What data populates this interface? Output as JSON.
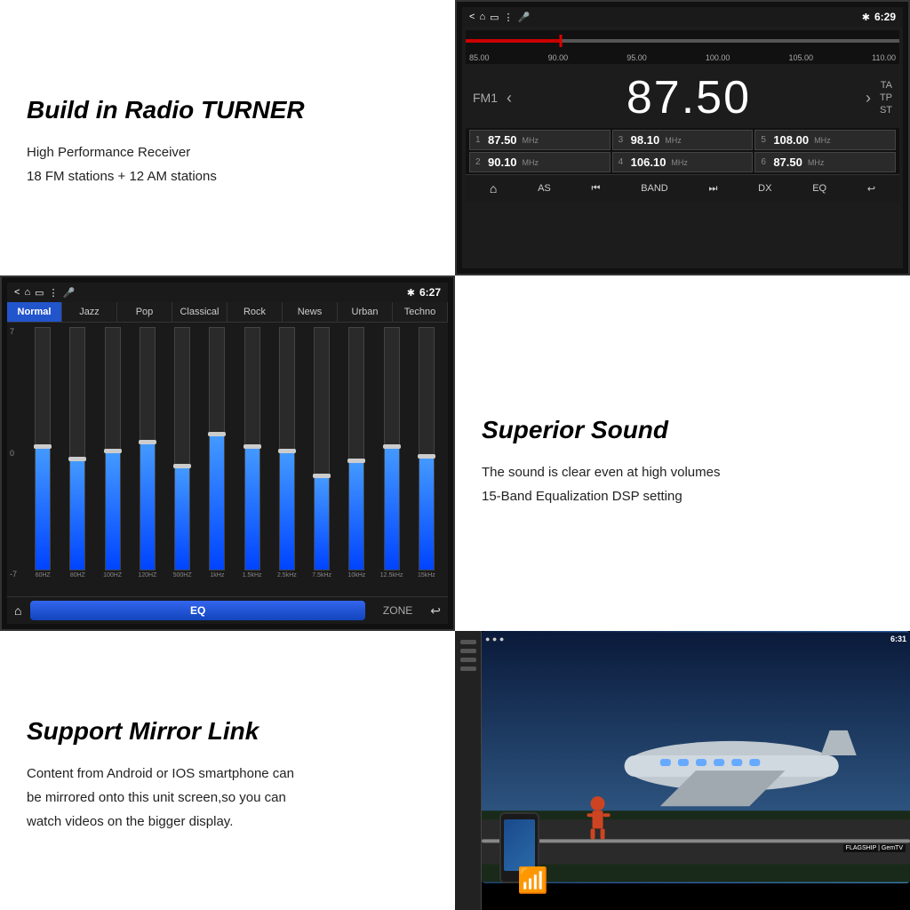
{
  "radio": {
    "section_title": "Build in Radio TURNER",
    "body_line1": "High Performance Receiver",
    "body_line2": "18 FM stations + 12 AM stations",
    "status_bar": {
      "icons": "< ⌂ ▭ ⋮ 🎤",
      "bluetooth": "✱",
      "time": "6:29"
    },
    "freq_labels": [
      "85.00",
      "90.00",
      "95.00",
      "100.00",
      "105.00",
      "110.00"
    ],
    "band": "FM1",
    "current_freq": "87.50",
    "ta": "TA",
    "tp": "TP",
    "st": "ST",
    "presets": [
      {
        "num": "1",
        "freq": "87.50",
        "unit": "MHz"
      },
      {
        "num": "3",
        "freq": "98.10",
        "unit": "MHz"
      },
      {
        "num": "5",
        "freq": "108.00",
        "unit": "MHz"
      },
      {
        "num": "2",
        "freq": "90.10",
        "unit": "MHz"
      },
      {
        "num": "4",
        "freq": "106.10",
        "unit": "MHz"
      },
      {
        "num": "6",
        "freq": "87.50",
        "unit": "MHz"
      }
    ],
    "toolbar": [
      "⌂",
      "AS",
      "⏮",
      "BAND",
      "⏭",
      "DX",
      "EQ",
      "↩"
    ]
  },
  "eq": {
    "status_bar": {
      "icons": "< ⌂ ▭ ⋮ 🎤",
      "bluetooth": "✱",
      "time": "6:27"
    },
    "tabs": [
      "Normal",
      "Jazz",
      "Pop",
      "Classical",
      "Rock",
      "News",
      "Urban",
      "Techno"
    ],
    "active_tab": "Normal",
    "level_labels": [
      "7",
      "0",
      "-7"
    ],
    "sliders": [
      {
        "label": "60HZ",
        "fill_pct": 50,
        "handle_pct": 50
      },
      {
        "label": "80HZ",
        "fill_pct": 45,
        "handle_pct": 45
      },
      {
        "label": "100HZ",
        "fill_pct": 48,
        "handle_pct": 48
      },
      {
        "label": "120HZ",
        "fill_pct": 52,
        "handle_pct": 52
      },
      {
        "label": "500HZ",
        "fill_pct": 42,
        "handle_pct": 42
      },
      {
        "label": "1kHz",
        "fill_pct": 55,
        "handle_pct": 55
      },
      {
        "label": "1.5kHz",
        "fill_pct": 50,
        "handle_pct": 50
      },
      {
        "label": "2.5kHz",
        "fill_pct": 48,
        "handle_pct": 48
      },
      {
        "label": "7.5kHz",
        "fill_pct": 38,
        "handle_pct": 38
      },
      {
        "label": "10kHz",
        "fill_pct": 44,
        "handle_pct": 44
      },
      {
        "label": "12.5kHz",
        "fill_pct": 50,
        "handle_pct": 50
      },
      {
        "label": "15kHz",
        "fill_pct": 46,
        "handle_pct": 46
      }
    ],
    "bottom": {
      "home": "⌂",
      "eq_label": "EQ",
      "zone_label": "ZONE",
      "back": "↩"
    }
  },
  "sound": {
    "section_title": "Superior Sound",
    "body_line1": "The sound is clear even at high volumes",
    "body_line2": "15-Band Equalization DSP setting"
  },
  "mirror": {
    "section_title": "Support Mirror Link",
    "body_line1": "Content from Android or IOS smartphone can",
    "body_line2": "be mirrored onto this unit screen,so you can",
    "body_line3": "watch videos on the  bigger display.",
    "screen_time": "6:31",
    "watermark": "FLAGSHIP | GemTV"
  }
}
